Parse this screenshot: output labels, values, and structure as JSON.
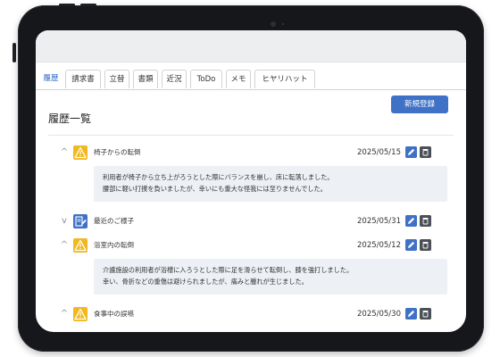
{
  "tabs": [
    {
      "label": "履歴",
      "active": true
    },
    {
      "label": "請求書",
      "active": false
    },
    {
      "label": "立替",
      "active": false
    },
    {
      "label": "書類",
      "active": false
    },
    {
      "label": "近況",
      "active": false
    },
    {
      "label": "ToDo",
      "active": false
    },
    {
      "label": "メモ",
      "active": false
    },
    {
      "label": "ヒヤリハット",
      "active": false
    }
  ],
  "header": {
    "title": "履歴一覧",
    "new_button": "新規登録"
  },
  "colors": {
    "accent": "#3f72c7",
    "warning": "#f2b81f",
    "note": "#3f72c7",
    "detail_bg": "#edf1f6"
  },
  "records": [
    {
      "expanded": true,
      "icon": "warning-icon",
      "title": "椅子からの転倒",
      "date": "2025/05/15",
      "details": [
        "利用者が椅子から立ち上がろうとした際にバランスを崩し、床に転落しました。",
        "腰部に軽い打撲を負いましたが、幸いにも重大な怪我には至りませんでした。"
      ]
    },
    {
      "expanded": false,
      "icon": "note-edit-icon",
      "title": "最近のご様子",
      "date": "2025/05/31",
      "details": []
    },
    {
      "expanded": true,
      "icon": "warning-icon",
      "title": "浴室内の転倒",
      "date": "2025/05/12",
      "details": [
        "介護施設の利用者が浴槽に入ろうとした際に足を滑らせて転倒し、膝を強打しました。",
        "幸い、骨折などの重傷は避けられましたが、痛みと腫れが生じました。"
      ]
    },
    {
      "expanded": true,
      "icon": "warning-icon",
      "title": "食事中の誤嚥",
      "date": "2025/05/30",
      "details": []
    }
  ]
}
